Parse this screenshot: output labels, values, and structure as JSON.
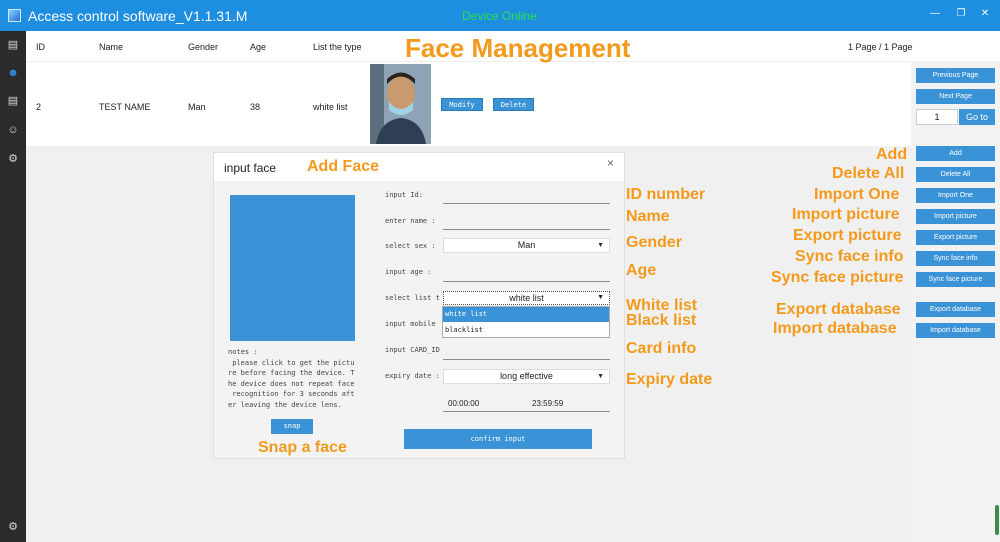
{
  "window": {
    "title": "Access control software_V1.1.31.M",
    "device_status": "Device Online",
    "device_status_color": "#27e04a",
    "accent_color": "#1e8ee0"
  },
  "sidebar": {
    "items": [
      {
        "icon": "menu-list-icon"
      },
      {
        "icon": "face-scan-icon",
        "active": true
      },
      {
        "icon": "document-icon"
      },
      {
        "icon": "user-settings-icon"
      },
      {
        "icon": "gear-icon"
      },
      {
        "icon": "settings-bottom-icon"
      }
    ]
  },
  "table": {
    "columns": [
      "ID",
      "Name",
      "Gender",
      "Age",
      "List the type"
    ],
    "rows": [
      {
        "id": "2",
        "name": "TEST NAME",
        "gender": "Man",
        "age": "38",
        "type": "white list",
        "modify": "Modify",
        "delete": "Delete"
      }
    ],
    "page_info": "1 Page / 1 Page"
  },
  "pager": {
    "previous": "Previous Page",
    "next": "Next Page",
    "page_input": "1",
    "goto": "Go to"
  },
  "actions": [
    {
      "label": "Add",
      "annotation": "Add"
    },
    {
      "label": "Delete All",
      "annotation": "Delete All"
    },
    {
      "label": "Import One",
      "annotation": "Import One"
    },
    {
      "label": "Import picture",
      "annotation": "Import picture"
    },
    {
      "label": "Export picture",
      "annotation": "Export picture"
    },
    {
      "label": "Sync face info",
      "annotation": "Sync face info"
    },
    {
      "label": "Sync face picture",
      "annotation": "Sync face picture"
    },
    {
      "label": "Export database",
      "annotation": "Export database"
    },
    {
      "label": "Import database",
      "annotation": "Import database"
    }
  ],
  "annotations": {
    "face_management": "Face Management",
    "add_face": "Add Face",
    "id_number": "ID number",
    "name": "Name",
    "gender": "Gender",
    "age": "Age",
    "white_list": "White list",
    "black_list": "Black list",
    "card_info": "Card info",
    "expiry_date": "Expiry date",
    "snap_face": "Snap a face"
  },
  "dialog": {
    "title": "input face",
    "close": "×",
    "notes": "notes :\n please click to get the pictu\nre before facing the device. T\nhe device does not repeat face\n recognition for 3 seconds aft\ner leaving the device lens.",
    "snap": "snap",
    "labels": {
      "input_id": "input Id:",
      "enter_name": "enter name :",
      "select_sex": "select sex :",
      "input_age": "input age :",
      "select_list": "select list t",
      "input_mobile": "input mobile",
      "input_card": "input CARD_ID",
      "expiry_date": "expiry date :"
    },
    "sex_value": "Man",
    "list_value": "white list",
    "list_options": [
      "white list",
      "blacklist"
    ],
    "expiry_value": "long effective",
    "time_start": "00:00:00",
    "time_end": "23:59:59",
    "confirm": "confirm input"
  }
}
